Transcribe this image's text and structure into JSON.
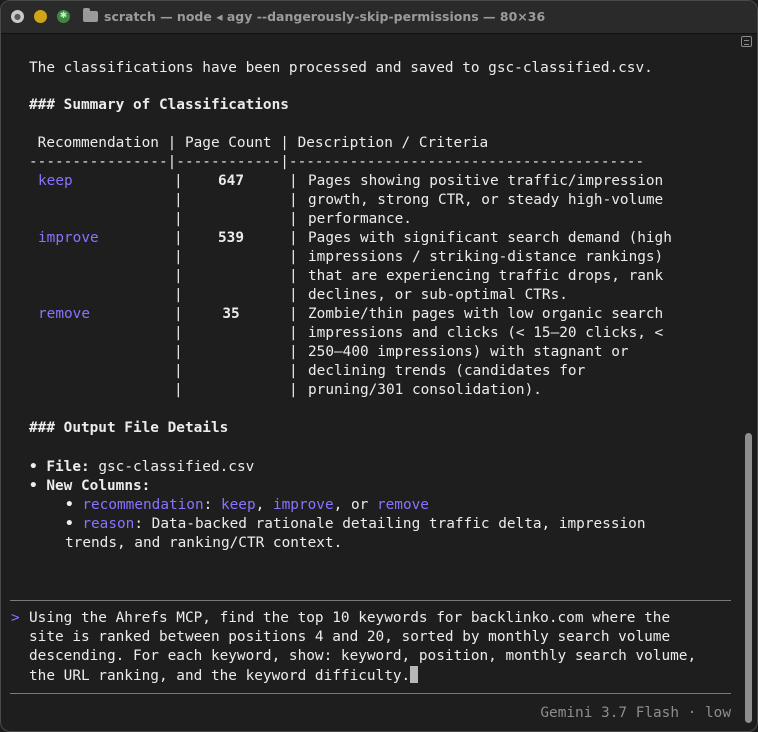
{
  "window": {
    "title": "scratch — node ◂ agy --dangerously-skip-permissions — 80×36"
  },
  "message": "The classifications have been processed and saved to gsc-classified.csv.",
  "summary_heading": "### Summary of Classifications",
  "table": {
    "header": " Recommendation | Page Count | Description / Criteria",
    "rule": "----------------|------------|-----------------------------------------",
    "pipe": "|",
    "rows": [
      {
        "name": "keep",
        "count": "647",
        "desc": [
          "Pages showing positive traffic/impression",
          "growth, strong CTR, or steady high-volume",
          "performance."
        ]
      },
      {
        "name": "improve",
        "count": "539",
        "desc": [
          "Pages with significant search demand (high",
          "impressions / striking-distance rankings)",
          "that are experiencing traffic drops, rank",
          "declines, or sub-optimal CTRs."
        ]
      },
      {
        "name": "remove",
        "count": "35",
        "desc": [
          "Zombie/thin pages with low organic search",
          "impressions and clicks (< 15–20 clicks, <",
          "250–400 impressions) with stagnant or",
          "declining trends (candidates for",
          "pruning/301 consolidation)."
        ]
      }
    ]
  },
  "output_heading": "### Output File Details",
  "output": {
    "bullet": "•",
    "file_label": "File:",
    "file_value": "gsc-classified.csv",
    "cols_label": "New Columns:",
    "rec_name": "recommendation",
    "rec_sep": ":",
    "rec_v1": "keep",
    "comma1": ",",
    "rec_v2": "improve",
    "comma_or": ", or",
    "rec_v3": "remove",
    "reason_name": "reason",
    "reason_text": ": Data-backed rationale detailing traffic delta, impression",
    "reason_text2": "trends, and ranking/CTR context."
  },
  "prompt": {
    "caret": ">",
    "lines": [
      "Using the Ahrefs MCP, find the top 10 keywords for backlinko.com where the",
      "site is ranked between positions 4 and 20, sorted by monthly search volume",
      "descending. For each keyword, show: keyword, position, monthly search volume,",
      "the URL ranking, and the keyword difficulty."
    ]
  },
  "status": {
    "model": "Gemini 3.7 Flash · low"
  }
}
